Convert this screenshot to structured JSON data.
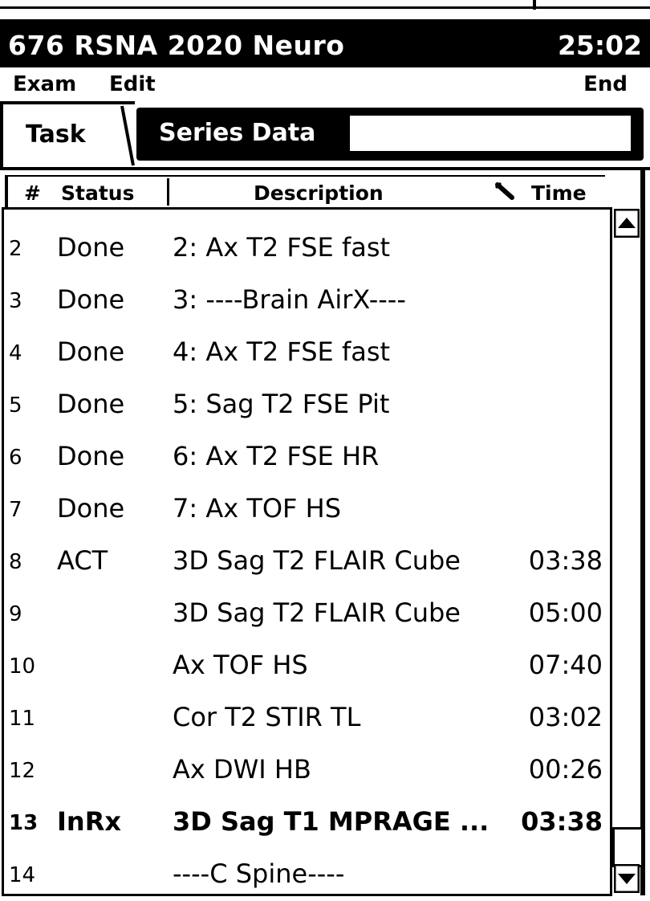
{
  "window": {
    "title": "676 RSNA 2020 Neuro",
    "time": "25:02"
  },
  "menu": {
    "exam": "Exam",
    "edit": "Edit",
    "end": "End"
  },
  "tabs": {
    "task": "Task",
    "series_data": "Series Data"
  },
  "table": {
    "headers": {
      "num": "#",
      "status": "Status",
      "description": "Description",
      "time": "Time"
    },
    "rows": [
      {
        "num": "2",
        "status": "Done",
        "description": "2: Ax T2 FSE fast",
        "time": ""
      },
      {
        "num": "3",
        "status": "Done",
        "description": "3: ----Brain AirX----",
        "time": ""
      },
      {
        "num": "4",
        "status": "Done",
        "description": "4: Ax T2 FSE fast",
        "time": ""
      },
      {
        "num": "5",
        "status": "Done",
        "description": "5: Sag T2 FSE Pit",
        "time": ""
      },
      {
        "num": "6",
        "status": "Done",
        "description": "6: Ax T2 FSE HR",
        "time": ""
      },
      {
        "num": "7",
        "status": "Done",
        "description": "7: Ax TOF HS",
        "time": ""
      },
      {
        "num": "8",
        "status": "ACT",
        "description": "3D Sag T2 FLAIR Cube",
        "time": "03:38"
      },
      {
        "num": "9",
        "status": "",
        "description": "3D Sag T2 FLAIR Cube",
        "time": "05:00"
      },
      {
        "num": "10",
        "status": "",
        "description": "Ax TOF HS",
        "time": "07:40"
      },
      {
        "num": "11",
        "status": "",
        "description": "Cor T2 STIR TL",
        "time": "03:02"
      },
      {
        "num": "12",
        "status": "",
        "description": "Ax DWI HB",
        "time": "00:26"
      },
      {
        "num": "13",
        "status": "InRx",
        "description": "3D Sag T1 MPRAGE ...",
        "time": "03:38"
      },
      {
        "num": "14",
        "status": "",
        "description": "----C Spine----",
        "time": ""
      }
    ]
  },
  "icons": {
    "clip": "paperclip-icon",
    "scroll_up": "scroll-up-arrow-icon",
    "scroll_down": "scroll-down-arrow-icon"
  }
}
